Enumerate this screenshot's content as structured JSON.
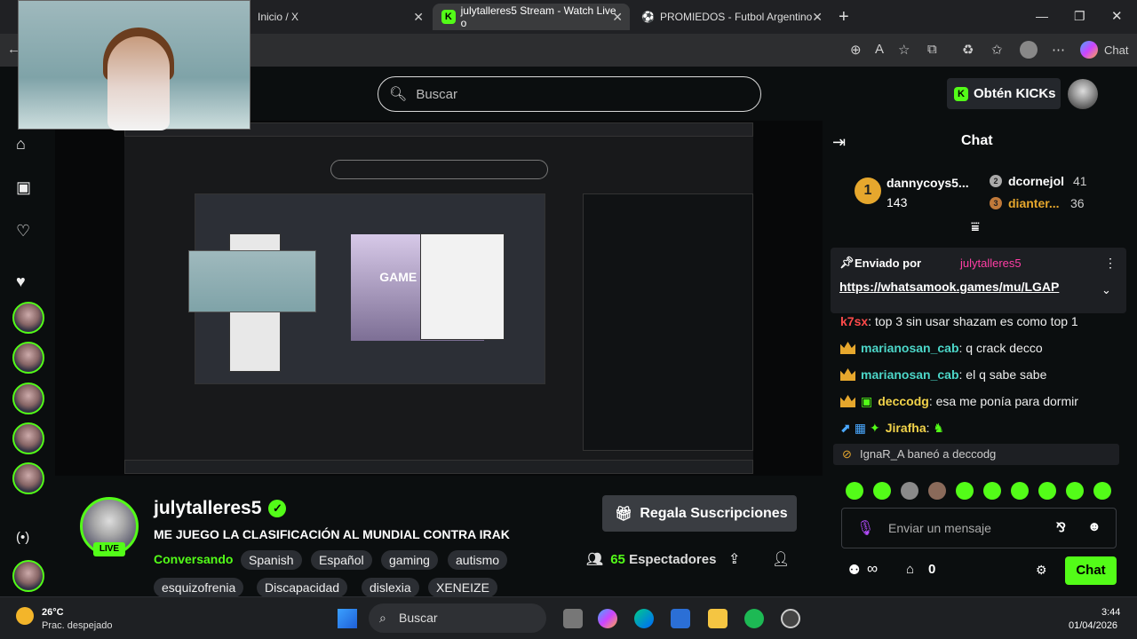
{
  "browser": {
    "tabs": [
      {
        "label": "Inicio / X"
      },
      {
        "label": "julytalleres5 Stream - Watch Live o"
      },
      {
        "label": "PROMIEDOS - Futbol Argentino - "
      }
    ],
    "chat_label": "Chat",
    "new_tab": "+"
  },
  "header": {
    "search_placeholder": "Buscar",
    "kicks_label": "Obtén KICKs"
  },
  "stream": {
    "name": "julytalleres5",
    "title": "ME JUEGO LA CLASIFICACIÓN AL MUNDIAL CONTRA IRAK",
    "category": "Conversando",
    "tags": [
      "Spanish",
      "Español",
      "gaming",
      "autismo",
      "esquizofrenia",
      "Discapacidad",
      "dislexia",
      "XENEIZE"
    ],
    "live_badge": "LIVE",
    "gift_label": "Regala Suscripciones",
    "viewers_count": "65",
    "viewers_label": "Espectadores",
    "game_over": "GAME OVER"
  },
  "chat": {
    "title": "Chat",
    "top_gifters": [
      {
        "rank": "1",
        "name": "dannycoys5...",
        "count": "143"
      },
      {
        "rank": "2",
        "name": "dcornejol",
        "count": "41"
      },
      {
        "rank": "3",
        "name": "dianter...",
        "count": "36"
      }
    ],
    "pinned": {
      "sent_by": "Enviado por",
      "user": "julytalleres5",
      "link": "https://whatsamook.games/mu/LGAP"
    },
    "messages": [
      {
        "user": "k7sx",
        "text": "top 3 sin usar shazam es como top 1"
      },
      {
        "user": "marianosan_cab",
        "text": "q crack decco"
      },
      {
        "user": "marianosan_cab",
        "text": "el q sabe sabe"
      },
      {
        "user": "deccodg",
        "text": "esa me ponía para dormir"
      },
      {
        "user": "Jirafha",
        "text": ""
      }
    ],
    "ban_notice": {
      "user": "IgnaR_A",
      "action": "baneó a",
      "target": "deccodg"
    },
    "input_placeholder": "Enviar un mensaje",
    "points": "0",
    "send_label": "Chat",
    "infinity": "∞"
  },
  "taskbar": {
    "weather_temp": "26°C",
    "weather_desc": "Prac. despejado",
    "search": "Buscar",
    "time": "3:44",
    "date": "01/04/2026"
  },
  "colors": {
    "accent": "#53fc18",
    "gold": "#e6a72d",
    "background": "#0b0e0f"
  }
}
